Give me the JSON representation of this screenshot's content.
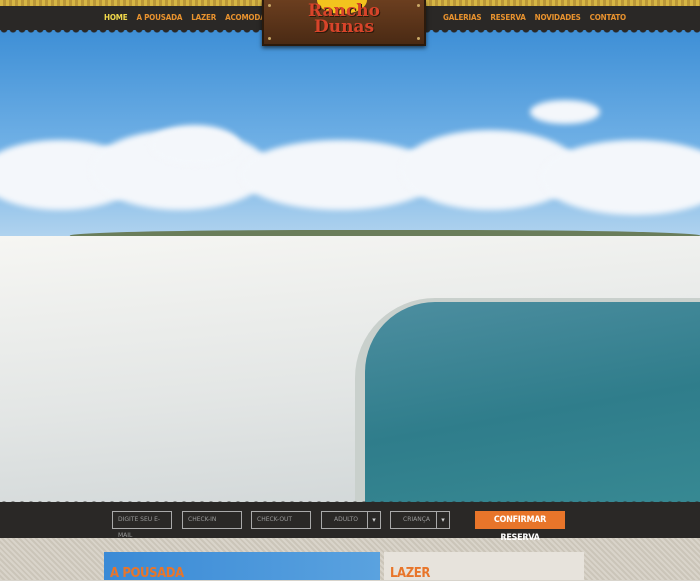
{
  "nav": {
    "left": [
      "HOME",
      "A POUSADA",
      "LAZER",
      "ACOMODAÇÕES"
    ],
    "right": [
      "GALERIAS",
      "RESERVA",
      "NOVIDADES",
      "CONTATO"
    ]
  },
  "logo": {
    "line1": "Rancho",
    "line2": "Dunas"
  },
  "booking": {
    "email_placeholder": "DIGITE SEU E-MAIL",
    "checkin_placeholder": "CHECK-IN",
    "checkout_placeholder": "CHECK-OUT",
    "adults_selected": "ADULTO",
    "children_selected": "CRIANÇA",
    "confirm_label": "CONFIRMAR RESERVA"
  },
  "sections": {
    "pousada_title": "A POUSADA",
    "lazer_title": "LAZER"
  },
  "colors": {
    "accent": "#e8752a",
    "nav_active": "#f2d94a",
    "bar": "#2a2826"
  }
}
